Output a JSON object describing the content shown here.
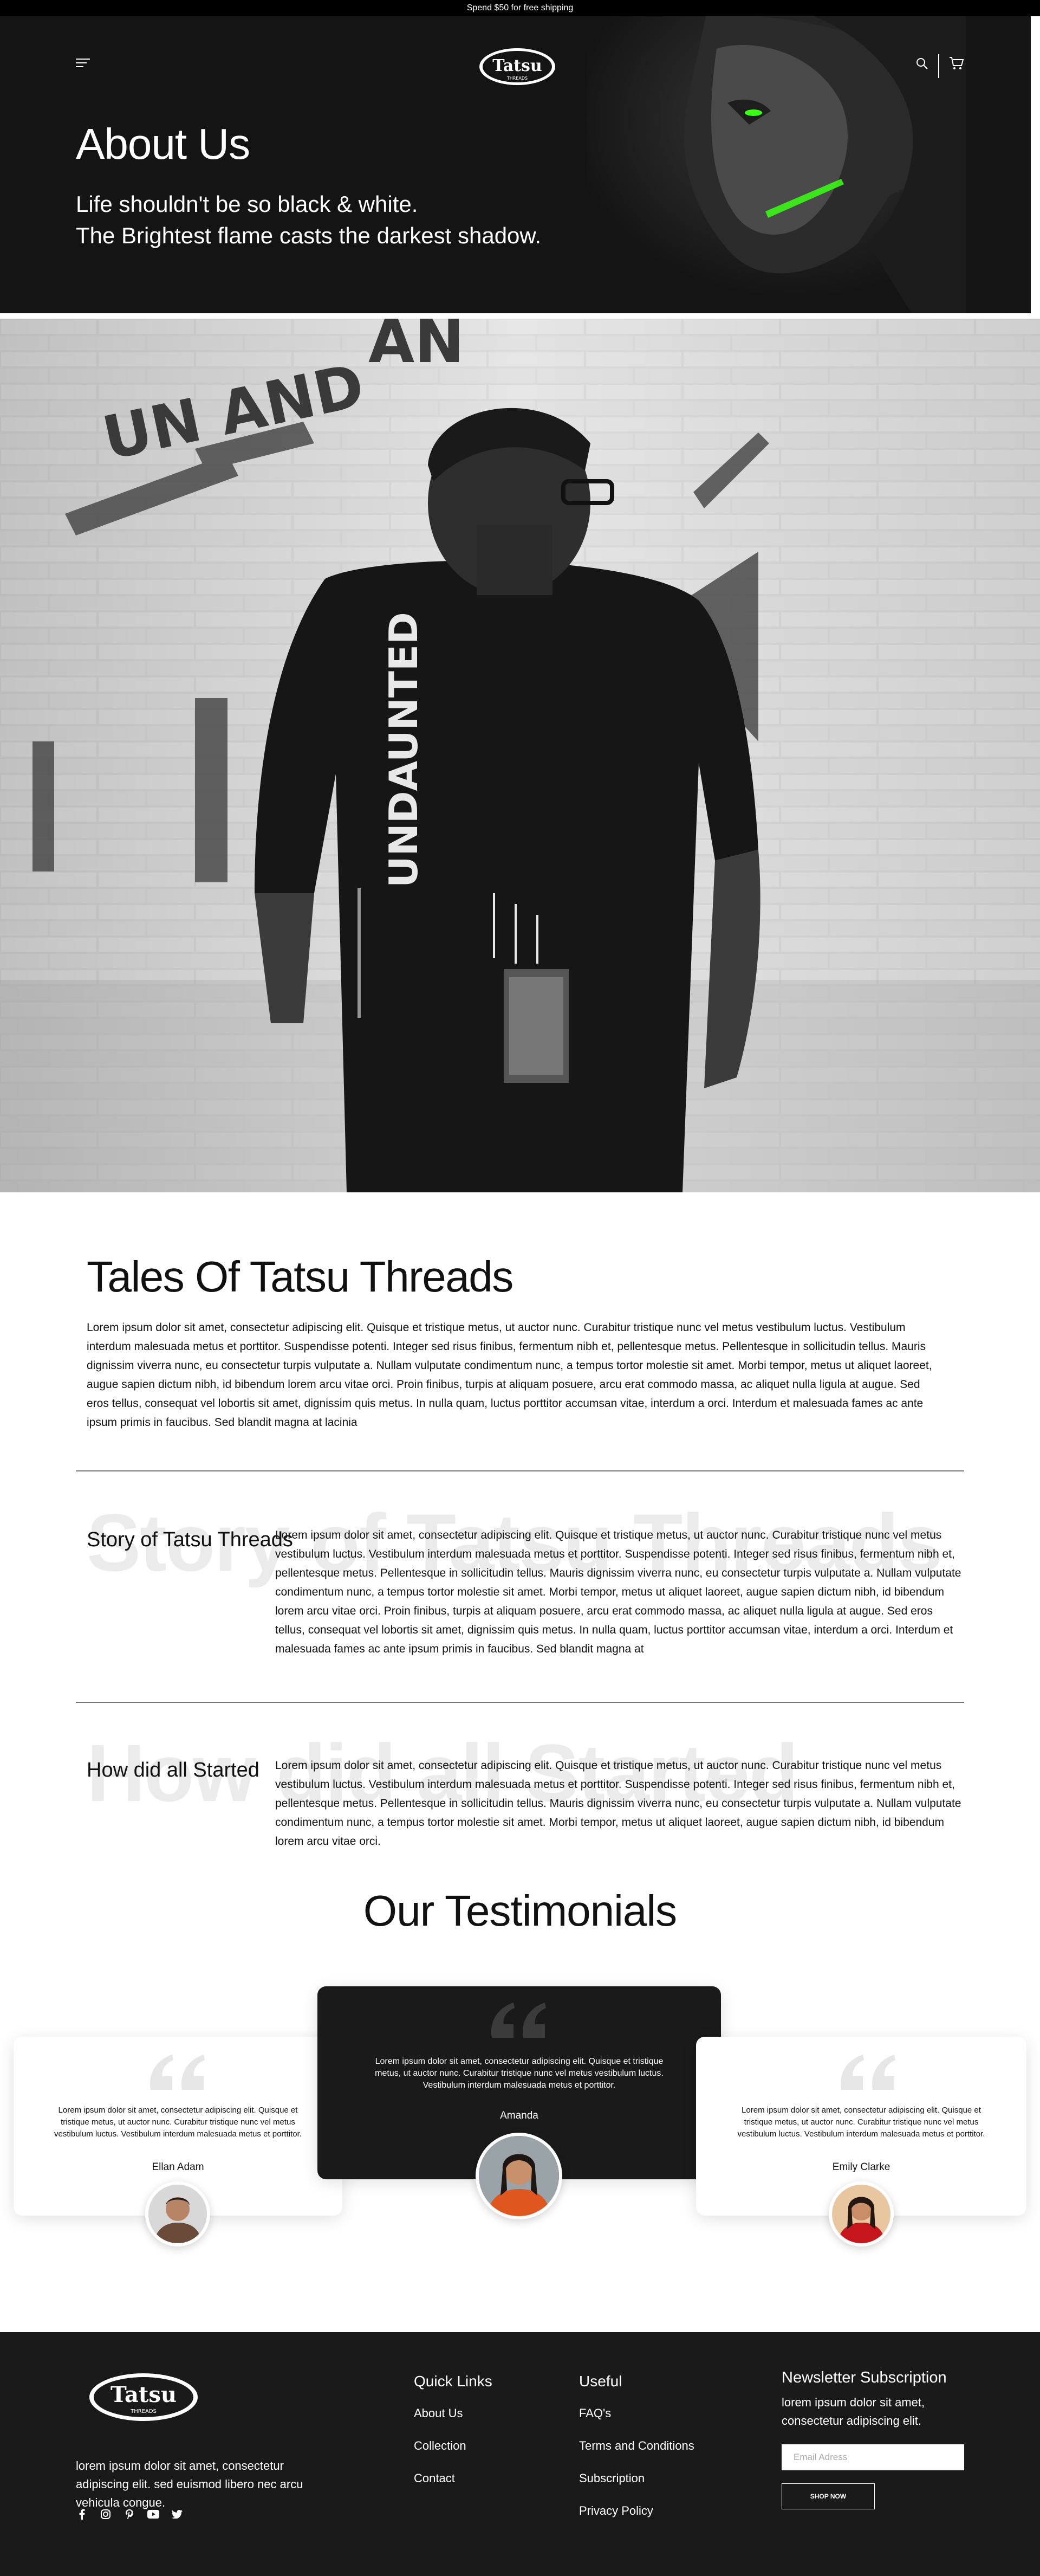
{
  "announcement": "Spend $50 for free shipping",
  "brand": {
    "logo_text": "Tatsu",
    "logo_sub": "THREADS"
  },
  "hero": {
    "title": "About Us",
    "subtitle_line1": "Life shouldn't be so black & white.",
    "subtitle_line2": "The Brightest flame casts the darkest shadow."
  },
  "tshirt_print": {
    "main": "UNDAUNTED"
  },
  "tales": {
    "title": "Tales Of Tatsu Threads",
    "body": "Lorem ipsum dolor sit amet, consectetur adipiscing elit. Quisque et tristique metus, ut auctor nunc. Curabitur tristique nunc vel metus vestibulum luctus. Vestibulum interdum malesuada metus et porttitor. Suspendisse potenti. Integer sed risus finibus, fermentum nibh et, pellentesque metus. Pellentesque in sollicitudin tellus. Mauris dignissim viverra nunc, eu consectetur turpis vulputate a. Nullam vulputate condimentum nunc, a tempus tortor molestie sit amet. Morbi tempor, metus ut aliquet laoreet, augue sapien dictum nibh, id bibendum lorem arcu vitae orci. Proin finibus, turpis at aliquam posuere, arcu erat commodo massa, ac aliquet nulla ligula at augue. Sed eros tellus, consequat vel lobortis sit amet, dignissim quis metus. In nulla quam, luctus porttitor accumsan vitae, interdum a orci. Interdum et malesuada fames ac ante ipsum primis in faucibus. Sed blandit magna at lacinia"
  },
  "story": {
    "bg_word": "Story of Tatsu Threads",
    "label": "Story of Tatsu Threads",
    "body": "Lorem ipsum dolor sit amet, consectetur adipiscing elit. Quisque et tristique metus, ut auctor nunc. Curabitur tristique nunc vel metus vestibulum luctus. Vestibulum interdum malesuada metus et porttitor. Suspendisse potenti. Integer sed risus finibus, fermentum nibh et, pellentesque metus. Pellentesque in sollicitudin tellus. Mauris dignissim viverra nunc, eu consectetur turpis vulputate a. Nullam vulputate condimentum nunc, a tempus tortor molestie sit amet. Morbi tempor, metus ut aliquet laoreet, augue sapien dictum nibh, id bibendum lorem arcu vitae orci. Proin finibus, turpis at aliquam posuere, arcu erat commodo massa, ac aliquet nulla ligula at augue. Sed eros tellus, consequat vel lobortis sit amet, dignissim quis metus. In nulla quam, luctus porttitor accumsan vitae, interdum a orci. Interdum et malesuada fames ac ante ipsum primis in faucibus. Sed blandit magna at"
  },
  "started": {
    "bg_word": "How did all Started",
    "label": "How did all Started",
    "body": "Lorem ipsum dolor sit amet, consectetur adipiscing elit. Quisque et tristique metus, ut auctor nunc. Curabitur tristique nunc vel metus vestibulum luctus. Vestibulum interdum malesuada metus et porttitor. Suspendisse potenti. Integer sed risus finibus, fermentum nibh et, pellentesque metus. Pellentesque in sollicitudin tellus. Mauris dignissim viverra nunc, eu consectetur turpis vulputate a. Nullam vulputate condimentum nunc, a tempus tortor molestie sit amet. Morbi tempor, metus ut aliquet laoreet, augue sapien dictum nibh, id bibendum lorem arcu vitae orci."
  },
  "testimonials": {
    "title": "Our Testimonials",
    "items": [
      {
        "text": "Lorem ipsum dolor sit amet, consectetur adipiscing elit. Quisque et tristique metus, ut auctor nunc. Curabitur tristique nunc vel metus vestibulum luctus. Vestibulum interdum malesuada metus et porttitor.",
        "name": "Ellan Adam"
      },
      {
        "text": "Lorem ipsum dolor sit amet, consectetur adipiscing elit. Quisque et tristique metus, ut auctor nunc. Curabitur tristique nunc vel metus vestibulum luctus. Vestibulum interdum malesuada metus et porttitor.",
        "name": "Amanda"
      },
      {
        "text": "Lorem ipsum dolor sit amet, consectetur adipiscing elit. Quisque et tristique metus, ut auctor nunc. Curabitur tristique nunc vel metus vestibulum luctus. Vestibulum interdum malesuada metus et porttitor.",
        "name": "Emily Clarke"
      }
    ]
  },
  "footer": {
    "about": "lorem ipsum dolor sit amet, consectetur adipiscing elit. sed euismod libero nec arcu vehicula congue.",
    "quick_links": {
      "title": "Quick Links",
      "items": [
        "About Us",
        "Collection",
        "Contact"
      ]
    },
    "useful": {
      "title": "Useful",
      "items": [
        "FAQ's",
        "Terms and Conditions",
        "Subscription",
        "Privacy Policy"
      ]
    },
    "newsletter": {
      "title": "Newsletter Subscription",
      "text": "lorem ipsum dolor sit amet, consectetur adipiscing elit.",
      "placeholder": "Email Adress",
      "button": "SHOP NOW"
    },
    "socials": [
      "facebook-icon",
      "instagram-icon",
      "pinterest-icon",
      "youtube-icon",
      "twitter-icon"
    ]
  },
  "colors": {
    "accent_green": "#39ff14",
    "dark": "#1a1a1a",
    "hero_bg": "#141414"
  }
}
